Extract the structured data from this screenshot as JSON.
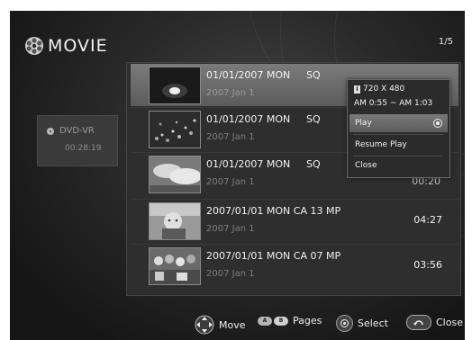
{
  "header": {
    "title": "MOVIE",
    "title_icon": "disc-icon",
    "page_indicator": "1/5"
  },
  "device": {
    "label": "DVD-VR",
    "time": "00:28:19"
  },
  "items": [
    {
      "line1": "01/01/2007 MON",
      "quality": "SQ",
      "line2": "2007 Jan 1",
      "duration": "",
      "thumb": "dark-flash",
      "selected": true
    },
    {
      "line1": "01/01/2007 MON",
      "quality": "SQ",
      "line2": "2007 Jan 1",
      "duration": "",
      "thumb": "night-lights"
    },
    {
      "line1": "01/01/2007 MON",
      "quality": "SQ",
      "line2": "2007 Jan 1",
      "duration": "",
      "thumb": "sky-clouds"
    },
    {
      "line1": "2007/01/01 MON CA 13 MP",
      "quality": "",
      "line2": "2007 Jan 1",
      "duration": "04:27",
      "thumb": "child-portrait"
    },
    {
      "line1": "2007/01/01 MON CA 07 MP",
      "quality": "",
      "line2": "2007 Jan 1",
      "duration": "03:56",
      "thumb": "crowd-scene"
    }
  ],
  "popup": {
    "resolution": "720 X 480",
    "time_range": "AM 0:55 ~ AM 1:03",
    "options": [
      "Play",
      "Resume Play",
      "Close"
    ]
  },
  "footer": {
    "move": "Move",
    "pages": "Pages",
    "select": "Select",
    "close": "Close",
    "pill_a": "A",
    "pill_b": "B"
  }
}
